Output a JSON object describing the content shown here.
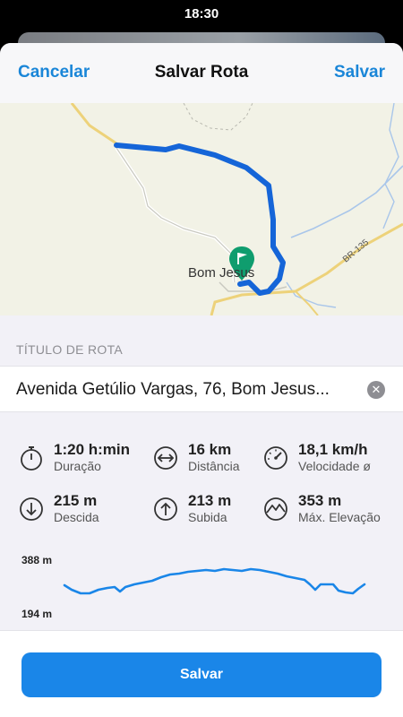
{
  "status_bar": {
    "time": "18:30"
  },
  "nav": {
    "cancel_label": "Cancelar",
    "title": "Salvar Rota",
    "save_label": "Salvar"
  },
  "map": {
    "place_label": "Bom Jesus",
    "road_label": "BR-135"
  },
  "route_title": {
    "section_label": "TÍTULO DE ROTA",
    "value": "Avenida Getúlio Vargas, 76, Bom Jesus..."
  },
  "stats": [
    {
      "icon": "stopwatch-icon",
      "value": "1:20 h:min",
      "label": "Duração"
    },
    {
      "icon": "distance-arrows-icon",
      "value": "16 km",
      "label": "Distância"
    },
    {
      "icon": "speedometer-icon",
      "value": "18,1 km/h",
      "label": "Velocidade ø"
    },
    {
      "icon": "arrow-down-icon",
      "value": "215 m",
      "label": "Descida"
    },
    {
      "icon": "arrow-up-icon",
      "value": "213 m",
      "label": "Subida"
    },
    {
      "icon": "mountain-icon",
      "value": "353 m",
      "label": "Máx. Elevação"
    }
  ],
  "elevation": {
    "max_label": "388 m",
    "min_label": "194 m"
  },
  "footer": {
    "save_label": "Salvar"
  },
  "colors": {
    "accent": "#1a86e8",
    "route": "#1565d8",
    "pin": "#0f9d6e"
  }
}
